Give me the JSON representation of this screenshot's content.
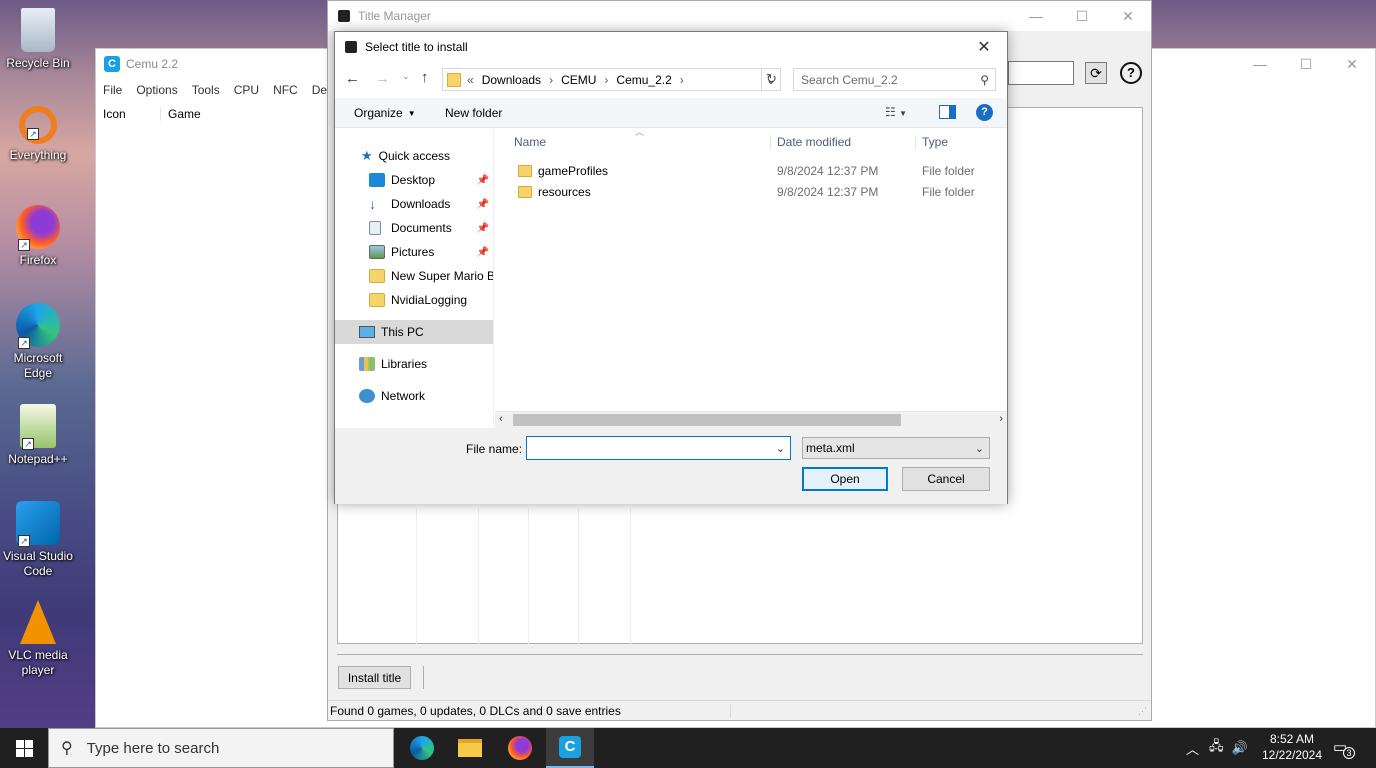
{
  "desktop": {
    "icons": [
      {
        "label": "Recycle Bin",
        "icon": "recycle-bin-icon"
      },
      {
        "label": "Everything",
        "icon": "everything-icon"
      },
      {
        "label": "Firefox",
        "icon": "firefox-icon"
      },
      {
        "label": "Microsoft Edge",
        "icon": "edge-icon"
      },
      {
        "label": "Notepad++",
        "icon": "notepadpp-icon"
      },
      {
        "label": "Visual Studio Code",
        "icon": "vscode-icon"
      },
      {
        "label": "VLC media player",
        "icon": "vlc-icon"
      }
    ]
  },
  "cemu": {
    "title": "Cemu 2.2",
    "menu": [
      "File",
      "Options",
      "Tools",
      "CPU",
      "NFC",
      "Deb"
    ],
    "columns": [
      "Icon",
      "Game"
    ]
  },
  "title_manager": {
    "title": "Title Manager",
    "install_button": "Install title",
    "status": "Found 0 games, 0 updates, 0 DLCs and 0 save entries"
  },
  "dialog": {
    "title": "Select title to install",
    "path": [
      "Downloads",
      "CEMU",
      "Cemu_2.2"
    ],
    "path_prefix": "«",
    "search_placeholder": "Search Cemu_2.2",
    "organize": "Organize",
    "new_folder": "New folder",
    "nav": {
      "quick_access": "Quick access",
      "items": [
        {
          "label": "Desktop",
          "pinned": true
        },
        {
          "label": "Downloads",
          "pinned": true
        },
        {
          "label": "Documents",
          "pinned": true
        },
        {
          "label": "Pictures",
          "pinned": true
        },
        {
          "label": "New Super Mario Br",
          "pinned": false
        },
        {
          "label": "NvidiaLogging",
          "pinned": false
        }
      ],
      "this_pc": "This PC",
      "libraries": "Libraries",
      "network": "Network"
    },
    "columns": {
      "name": "Name",
      "date": "Date modified",
      "type": "Type"
    },
    "files": [
      {
        "name": "gameProfiles",
        "date": "9/8/2024 12:37 PM",
        "type": "File folder"
      },
      {
        "name": "resources",
        "date": "9/8/2024 12:37 PM",
        "type": "File folder"
      }
    ],
    "file_name_label": "File name:",
    "file_name_value": "",
    "filter": "meta.xml",
    "open": "Open",
    "cancel": "Cancel"
  },
  "taskbar": {
    "search_placeholder": "Type here to search",
    "time": "8:52 AM",
    "date": "12/22/2024",
    "notifications": "3"
  }
}
